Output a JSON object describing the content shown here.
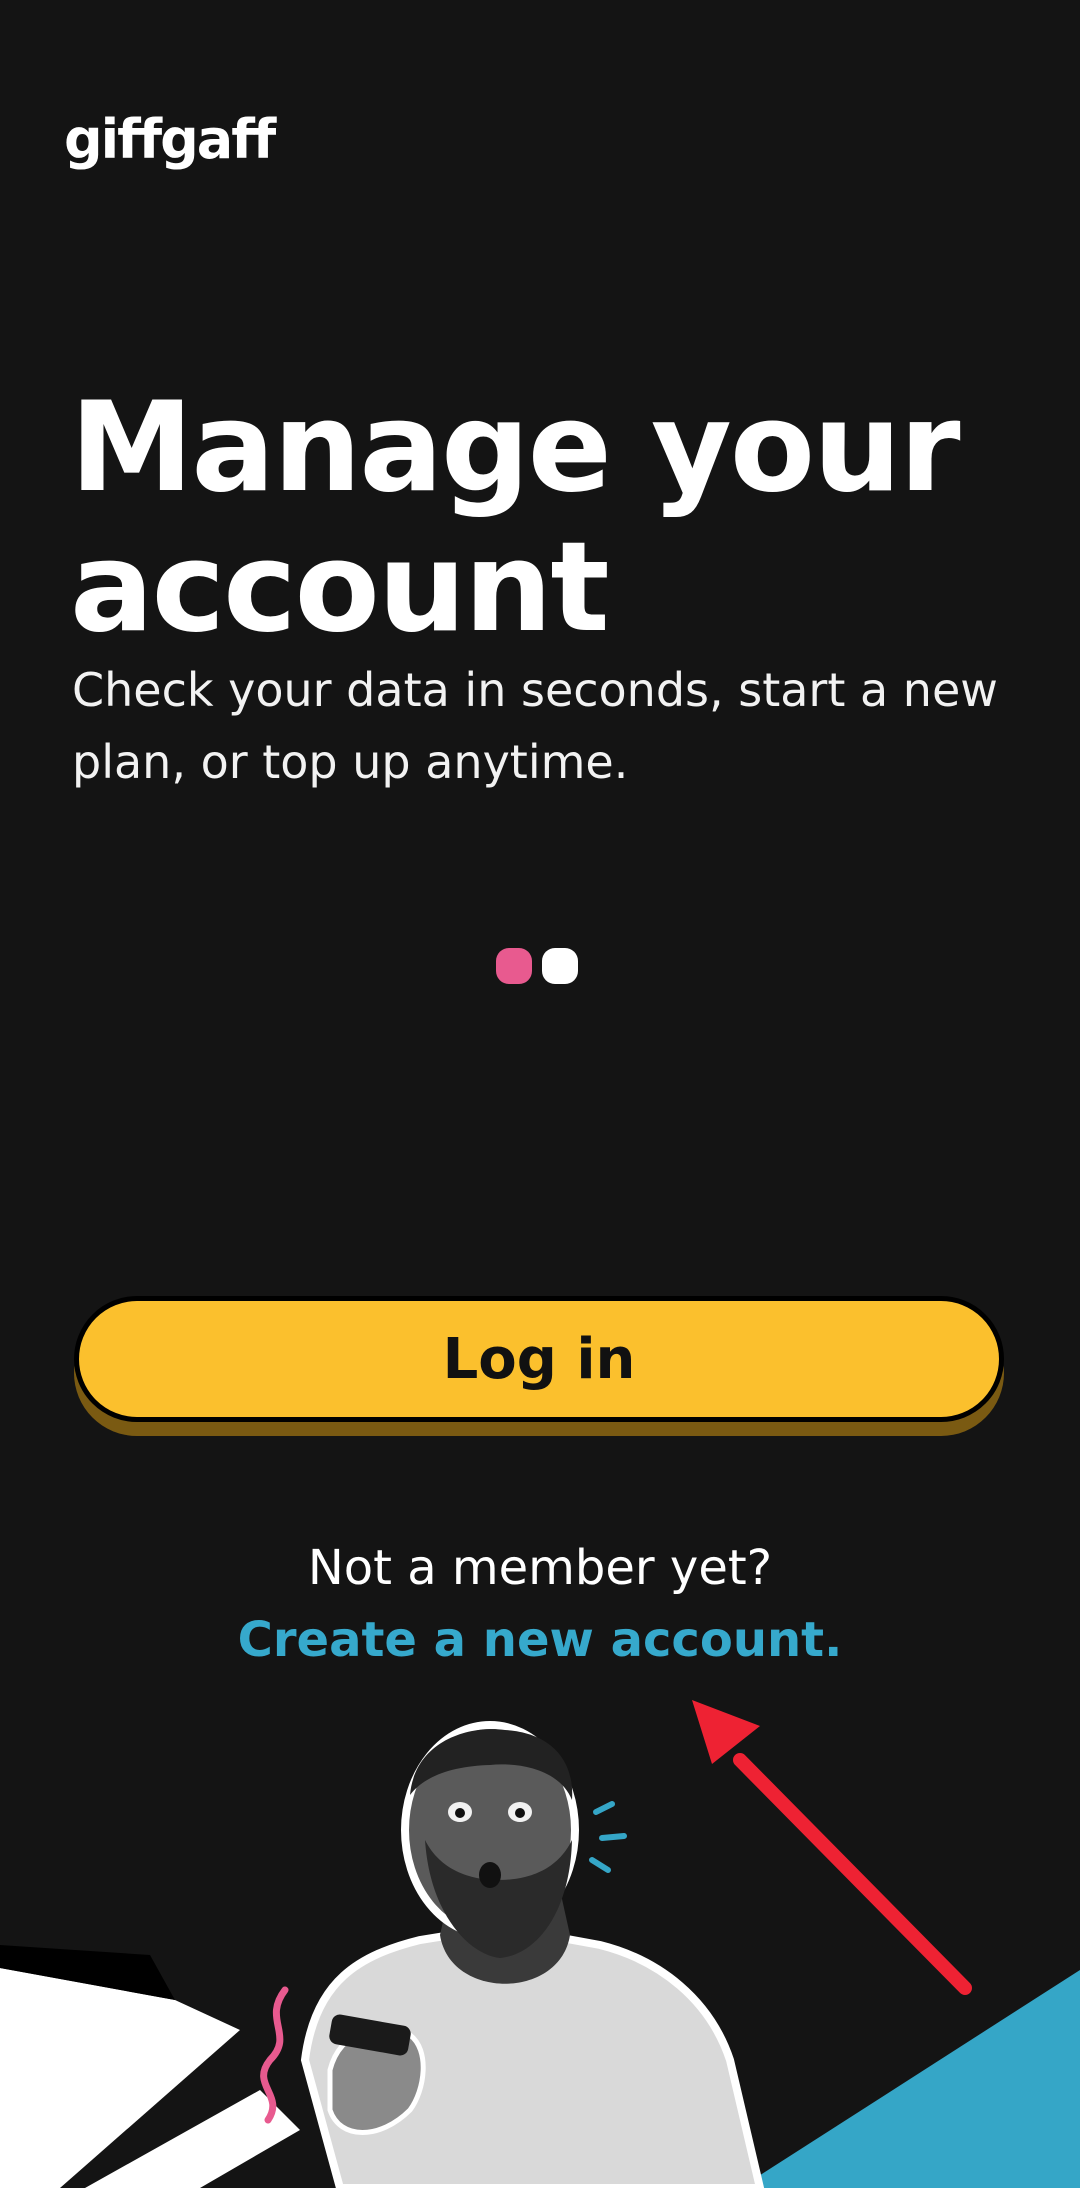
{
  "brand": {
    "logo_text": "giffgaff"
  },
  "onboarding": {
    "headline": "Manage your account",
    "subtitle": "Check your data in seconds, start a new plan, or top up anytime.",
    "pager": {
      "page_count": 2,
      "current_page": 1
    }
  },
  "actions": {
    "login_label": "Log in",
    "not_member_text": "Not a member yet?",
    "create_account_label": "Create a new account."
  },
  "colors": {
    "background": "#141414",
    "accent_yellow": "#fbc02d",
    "link_blue": "#36a9cc",
    "dot_pink": "#e85a8f",
    "annotation_red": "#ee2233"
  },
  "icons": {
    "illustration": "person-looking-at-phone-illustration",
    "annotation": "red-arrow-annotation"
  }
}
